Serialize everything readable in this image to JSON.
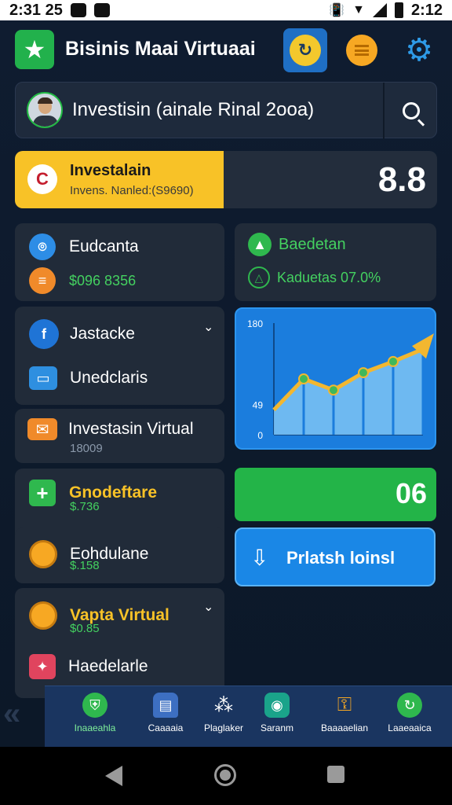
{
  "status_bar": {
    "time_left": "2:31 25",
    "time_right": "2:12"
  },
  "app": {
    "title": "Bisinis Maai Virtuaai"
  },
  "search": {
    "text": "Investisin (ainale Rinal 2ooa)"
  },
  "balance": {
    "title": "Investalain",
    "subtitle": "Invens. Nanled:(S9690)",
    "value": "8.8"
  },
  "left_cards": {
    "card1": {
      "item1": "Eudcanta",
      "item2": "$096 8356"
    },
    "card2": {
      "item1": "Jastacke",
      "item2": "Unedclaris"
    },
    "card3": {
      "title": "Investasin Virtual",
      "sub": "18009"
    },
    "card4": {
      "title": "Gnodeftare",
      "sub": "$.736"
    },
    "card5": {
      "title": "Eohdulane",
      "sub": "$.158"
    },
    "card6": {
      "title": "Vapta Virtual",
      "sub": "$0.85",
      "item2": "Haedelarle"
    }
  },
  "stats_card": {
    "item1": "Baedetan",
    "item2": "Kaduetas 07.0%"
  },
  "chart_data": {
    "type": "area",
    "tick_labels": [
      "0",
      "49",
      "180"
    ],
    "ylim": [
      0,
      180
    ],
    "x": [
      0,
      1,
      2,
      3,
      4,
      5
    ],
    "values": [
      40,
      90,
      72,
      100,
      118,
      138
    ],
    "colors": {
      "area": "#7cc3f5",
      "line": "#f2b730",
      "point": "#3fb85a"
    }
  },
  "green_card": {
    "value": "06"
  },
  "action_button": {
    "label": "Prlatsh loinsl"
  },
  "bottom_nav": [
    {
      "label": "Inaaeahla"
    },
    {
      "label": "Caaaaia"
    },
    {
      "label": "Plaglaker"
    },
    {
      "label": "Saranm"
    },
    {
      "label": "Baaaaelian"
    },
    {
      "label": "Laaeaaica"
    }
  ],
  "colors": {
    "background": "#0d1726",
    "card": "#212b39",
    "accent_yellow": "#f8c227",
    "accent_green": "#23b448",
    "accent_blue": "#1a87e6",
    "nav_bg": "#1a3560"
  }
}
